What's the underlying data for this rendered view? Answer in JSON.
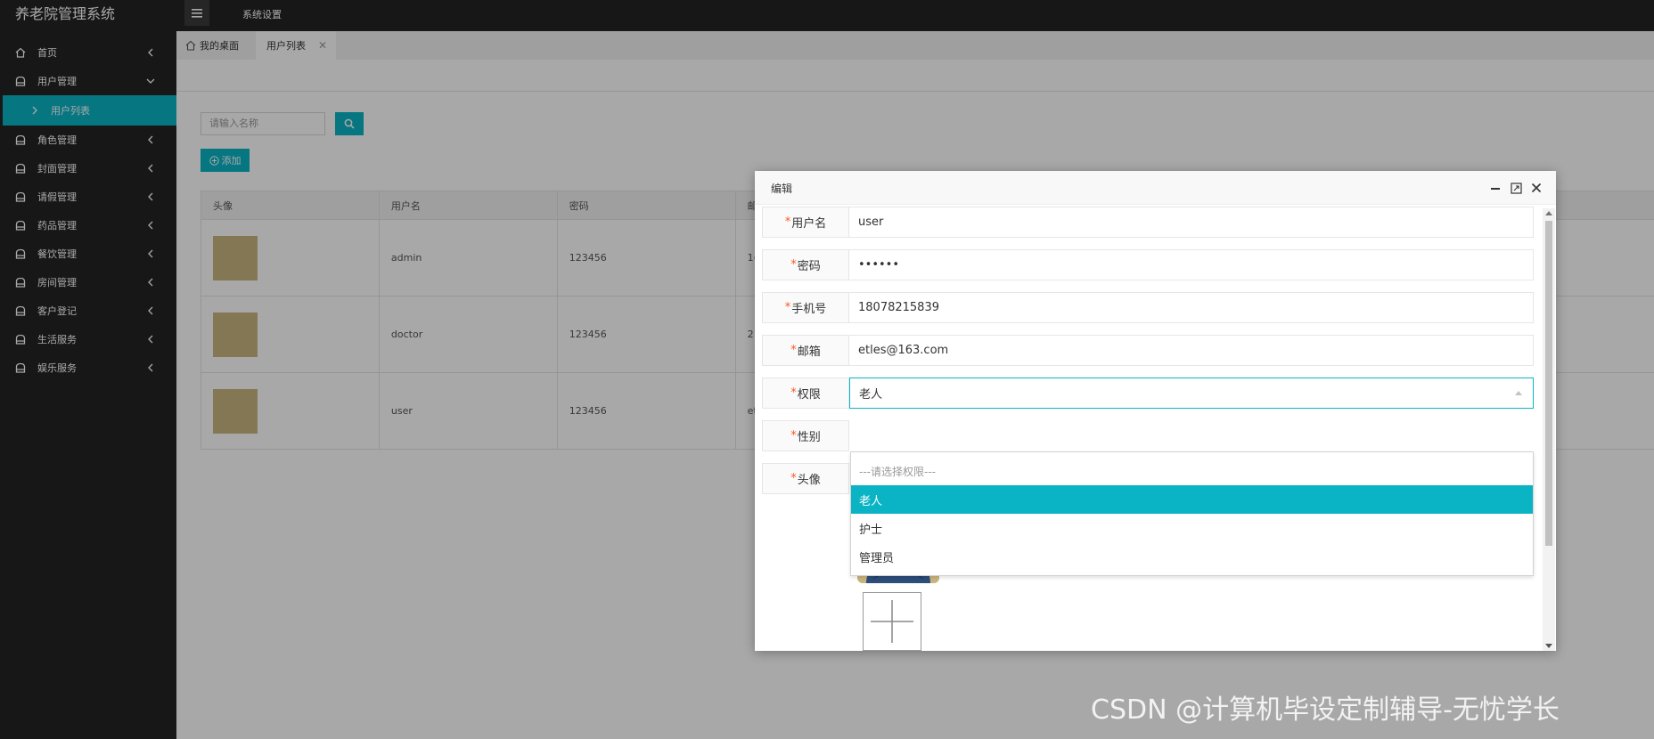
{
  "app": {
    "title": "养老院管理系统",
    "topnav_item": "系统设置"
  },
  "sidebar": {
    "items": [
      {
        "label": "首页",
        "icon": "home-icon"
      },
      {
        "label": "用户管理",
        "icon": "bag-icon",
        "expanded": true
      },
      {
        "label": "角色管理",
        "icon": "bag-icon"
      },
      {
        "label": "封面管理",
        "icon": "bag-icon"
      },
      {
        "label": "请假管理",
        "icon": "bag-icon"
      },
      {
        "label": "药品管理",
        "icon": "bag-icon"
      },
      {
        "label": "餐饮管理",
        "icon": "bag-icon"
      },
      {
        "label": "房间管理",
        "icon": "bag-icon"
      },
      {
        "label": "客户登记",
        "icon": "bag-icon"
      },
      {
        "label": "生活服务",
        "icon": "bag-icon"
      },
      {
        "label": "娱乐服务",
        "icon": "bag-icon"
      }
    ],
    "sub_item": "用户列表",
    "accent": "#0ab4c4"
  },
  "tabs": [
    {
      "label": "我的桌面",
      "icon": "home-icon"
    },
    {
      "label": "用户列表",
      "closable": true
    }
  ],
  "toolbar": {
    "search_placeholder": "请输入名称",
    "add_label": "添加"
  },
  "table": {
    "headers": [
      "头像",
      "用户名",
      "密码",
      "邮"
    ],
    "rows": [
      {
        "username": "admin",
        "password": "123456",
        "extra": "1("
      },
      {
        "username": "doctor",
        "password": "123456",
        "extra": "2"
      },
      {
        "username": "user",
        "password": "123456",
        "extra": "et"
      }
    ]
  },
  "dialog": {
    "title": "编辑",
    "fields": [
      {
        "label": "用户名",
        "value": "user"
      },
      {
        "label": "密码",
        "value": "••••••"
      },
      {
        "label": "手机号",
        "value": "18078215839"
      },
      {
        "label": "邮箱",
        "value": "etles@163.com"
      },
      {
        "label": "权限",
        "value": "老人"
      },
      {
        "label": "性别",
        "value": ""
      },
      {
        "label": "头像",
        "value": ""
      }
    ],
    "required_mark": "*",
    "dropdown": {
      "placeholder": "---请选择权限---",
      "options": [
        "老人",
        "护士",
        "管理员"
      ],
      "selected": "老人"
    }
  },
  "watermark": "CSDN @计算机毕设定制辅导-无忧学长"
}
